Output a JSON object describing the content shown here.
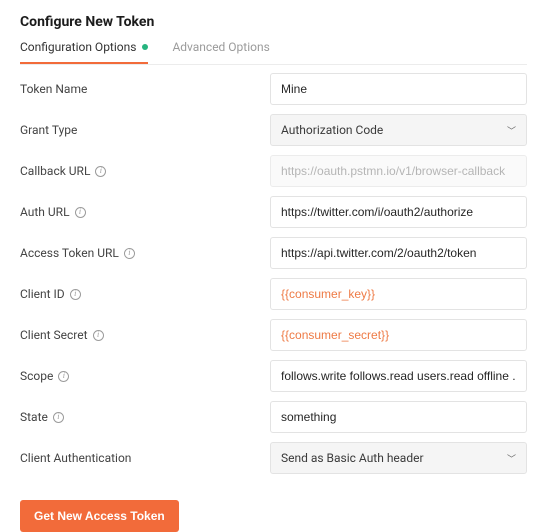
{
  "title": "Configure New Token",
  "tabs": {
    "config": "Configuration Options",
    "advanced": "Advanced Options"
  },
  "labels": {
    "token_name": "Token Name",
    "grant_type": "Grant Type",
    "callback_url": "Callback URL",
    "auth_url": "Auth URL",
    "access_token_url": "Access Token URL",
    "client_id": "Client ID",
    "client_secret": "Client Secret",
    "scope": "Scope",
    "state": "State",
    "client_auth": "Client Authentication"
  },
  "values": {
    "token_name": "Mine",
    "grant_type": "Authorization Code",
    "callback_url_placeholder": "https://oauth.pstmn.io/v1/browser-callback",
    "auth_url": "https://twitter.com/i/oauth2/authorize",
    "access_token_url": "https://api.twitter.com/2/oauth2/token",
    "client_id": "{{consumer_key}}",
    "client_secret": "{{consumer_secret}}",
    "scope": "follows.write follows.read users.read offline ...",
    "state": "something",
    "client_auth": "Send as Basic Auth header"
  },
  "actions": {
    "get_token": "Get New Access Token"
  },
  "info_glyph": "i"
}
